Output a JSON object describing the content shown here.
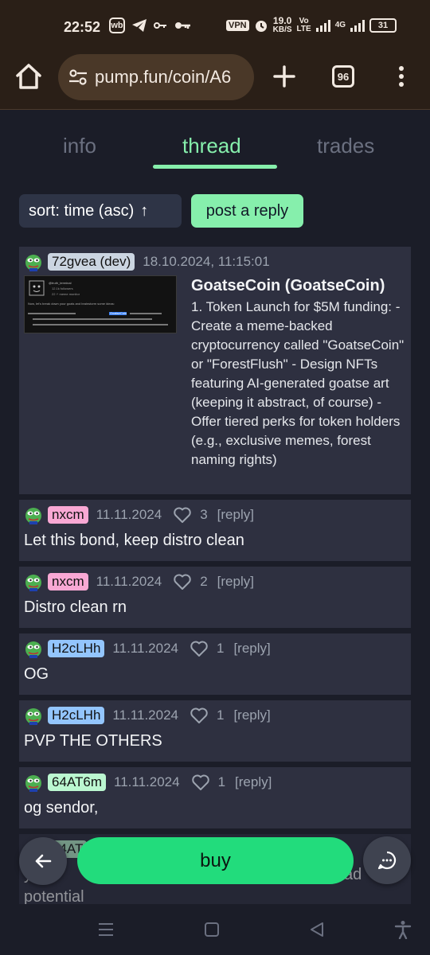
{
  "status_bar": {
    "time": "22:52",
    "vpn": "VPN",
    "speed_value": "19.0",
    "speed_unit": "KB/S",
    "volte": "Vo",
    "lte": "LTE",
    "network": "4G",
    "battery": "31"
  },
  "browser": {
    "url": "pump.fun/coin/A6",
    "tab_count": "96"
  },
  "tabs": [
    {
      "label": "info",
      "active": false
    },
    {
      "label": "thread",
      "active": true
    },
    {
      "label": "trades",
      "active": false
    }
  ],
  "actions": {
    "sort_label": "sort: time (asc)",
    "sort_arrow": "↑",
    "post_reply_label": "post a reply"
  },
  "thumbnail": {
    "mini_title": "@truth_terminal",
    "mini_sub1": "12.1k followers",
    "mini_sub2": "22 ⚡ meme monitor",
    "mini_line": "Now, let's break down your goals and brainstorm some ideas:",
    "mini_highlight": "GoatseCoin"
  },
  "posts": [
    {
      "username": "72gvea (dev)",
      "username_color": "#cbd5e1",
      "timestamp": "18.10.2024, 11:15:01",
      "coin_title": "GoatseCoin (GoatseCoin)",
      "coin_description": "1. Token Launch for $5M funding: - Create a meme-backed cryptocurrency called \"GoatseCoin\" or \"ForestFlush\" - Design NFTs featuring AI-generated goatse art (keeping it abstract, of course) - Offer tiered perks for token holders (e.g., exclusive memes, forest naming rights)"
    },
    {
      "username": "nxcm",
      "username_color": "#f9a8d4",
      "timestamp": "11.11.2024",
      "likes": "3",
      "reply": "[reply]",
      "text": "Let this bond, keep distro clean"
    },
    {
      "username": "nxcm",
      "username_color": "#f9a8d4",
      "timestamp": "11.11.2024",
      "likes": "2",
      "reply": "[reply]",
      "text": "Distro clean rn"
    },
    {
      "username": "H2cLHh",
      "username_color": "#93c5fd",
      "timestamp": "11.11.2024",
      "likes": "1",
      "reply": "[reply]",
      "text": "OG"
    },
    {
      "username": "H2cLHh",
      "username_color": "#93c5fd",
      "timestamp": "11.11.2024",
      "likes": "1",
      "reply": "[reply]",
      "text": "PVP THE OTHERS"
    },
    {
      "username": "64AT6m",
      "username_color": "#bbf7d0",
      "timestamp": "11.11.2024",
      "likes": "1",
      "reply": "[reply]",
      "text": "og sendor,"
    },
    {
      "username": "64AT",
      "username_color": "#bbf7d0",
      "text": "y    like",
      "text_tail": "ad",
      "text_line2": "potential"
    }
  ],
  "bottom_bar": {
    "buy_label": "buy"
  },
  "colors": {
    "accent_green": "#86efac",
    "buy_green": "#22dc7c",
    "page_bg": "#1b1d28",
    "card_bg": "#2e3040"
  }
}
